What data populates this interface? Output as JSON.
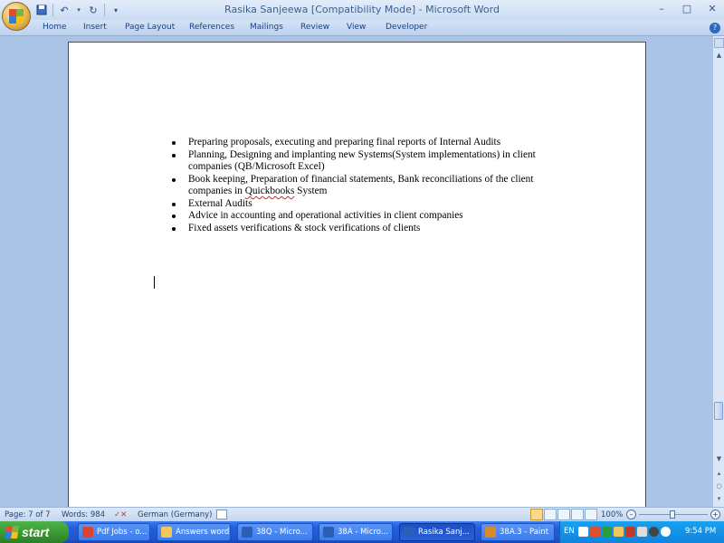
{
  "window": {
    "title": "Rasika Sanjeewa [Compatibility Mode] - Microsoft Word"
  },
  "quick_access": {
    "save_icon": "save-icon",
    "undo_icon": "undo-icon",
    "redo_icon": "redo-icon"
  },
  "ribbon": {
    "tabs": [
      "Home",
      "Insert",
      "Page Layout",
      "References",
      "Mailings",
      "Review",
      "View",
      "Developer"
    ]
  },
  "document": {
    "bullets": [
      "Preparing proposals, executing and preparing final reports of Internal Audits",
      "Planning, Designing and implanting new Systems(System implementations) in client companies (QB/Microsoft Excel)",
      "Book keeping, Preparation of financial statements, Bank reconciliations of the client companies in ",
      "External Audits",
      "Advice in accounting and operational activities in client companies",
      "Fixed assets verifications & stock verifications of clients"
    ],
    "misspelled_word": "Quickbooks",
    "after_misspelled": " System"
  },
  "status": {
    "page": "Page: 7 of 7",
    "words": "Words: 984",
    "language": "German (Germany)",
    "zoom": "100%"
  },
  "taskbar": {
    "start_label": "start",
    "tasks": [
      {
        "label": "Pdf Jobs - o...",
        "color": "#d9452f"
      },
      {
        "label": "Answers word",
        "color": "#f2c75c"
      },
      {
        "label": "38Q - Micro...",
        "color": "#2b5fb5"
      },
      {
        "label": "38A - Micro...",
        "color": "#2b5fb5"
      },
      {
        "label": "Rasika Sanj...",
        "color": "#2b5fb5"
      },
      {
        "label": "38A.3 - Paint",
        "color": "#d88a2a"
      }
    ],
    "tray_lang": "EN",
    "clock": "9:54 PM"
  }
}
